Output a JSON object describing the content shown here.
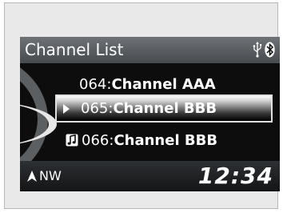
{
  "header": {
    "title": "Channel List",
    "icons": [
      "usb-icon",
      "bluetooth-icon"
    ]
  },
  "channels": [
    {
      "number": "064",
      "name": "Channel AAA",
      "selected": false,
      "playing": false
    },
    {
      "number": "065",
      "name": "Channel BBB",
      "selected": true,
      "playing": false
    },
    {
      "number": "066",
      "name": "Channel BBB",
      "selected": false,
      "playing": true
    }
  ],
  "separator": ":",
  "footer": {
    "compass_direction": "NW",
    "clock": "12:34"
  },
  "colors": {
    "screen_background": "#0d0d0d",
    "header_background": "#5a5e62",
    "frame_background": "#e9e9e9",
    "text": "#ffffff"
  }
}
